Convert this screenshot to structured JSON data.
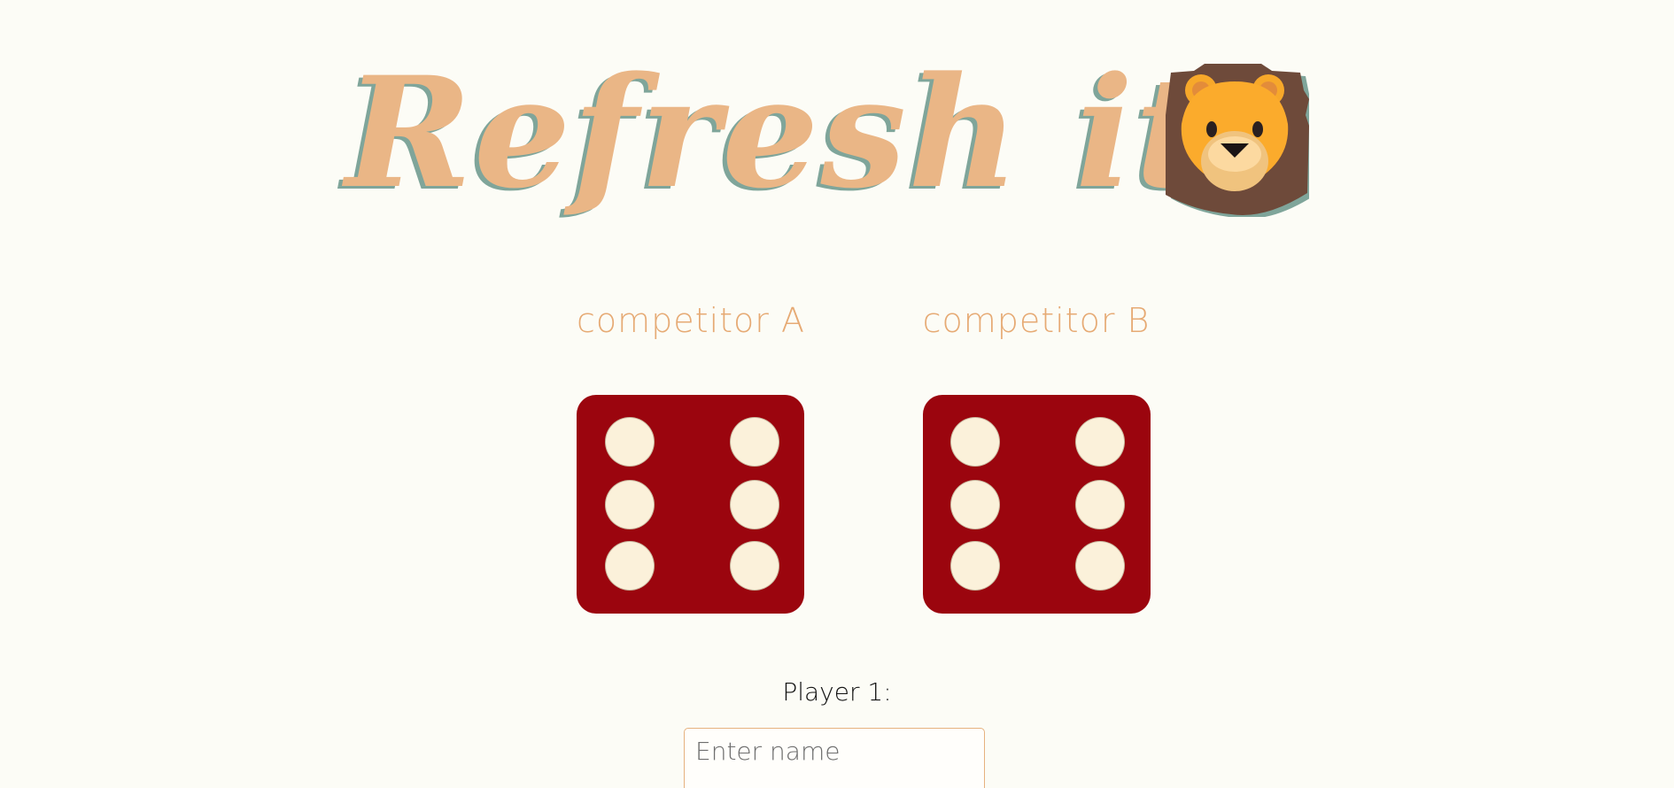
{
  "header": {
    "title": "Refresh it",
    "emoji_icon": "lion-face-icon"
  },
  "dice": [
    {
      "label": "competitor A",
      "value": 6
    },
    {
      "label": "competitor B",
      "value": 6
    }
  ],
  "player": {
    "label": "Player 1:",
    "name_value": "",
    "name_placeholder": "Enter name"
  },
  "colors": {
    "background": "#fcfcf6",
    "title": "#eab686",
    "title_shadow": "#7fa59a",
    "die": "#9b050e",
    "pip": "#fbf1da",
    "input_border": "#e6b27f"
  }
}
